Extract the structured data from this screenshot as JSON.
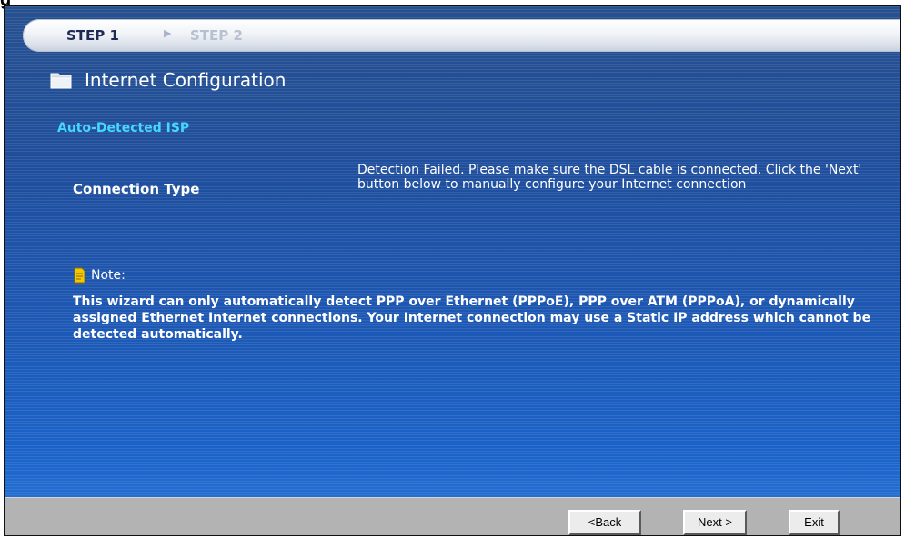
{
  "figure_heading": "g",
  "wizard": {
    "step1": "STEP 1",
    "step2": "STEP 2",
    "title": "Internet Configuration",
    "section_heading": "Auto-Detected ISP",
    "connection_type_label": "Connection Type",
    "connection_message": "Detection Failed. Please make sure the DSL cable is connected. Click the 'Next' button below to manually configure your Internet connection",
    "note_label": "Note:",
    "note_text": "This wizard can only automatically detect PPP over Ethernet (PPPoE), PPP over ATM (PPPoA), or dynamically assigned Ethernet Internet connections. Your Internet connection may use a Static IP address which cannot be detected automatically."
  },
  "buttons": {
    "back": "<Back",
    "next": "Next >",
    "exit": "Exit"
  },
  "icons": {
    "title": "folder-icon",
    "note": "note-icon",
    "step_separator": "chevron-right-icon"
  },
  "colors": {
    "section_heading": "#43d8ff",
    "text": "#ffffff",
    "bottom_bar": "#b3b3b3"
  }
}
